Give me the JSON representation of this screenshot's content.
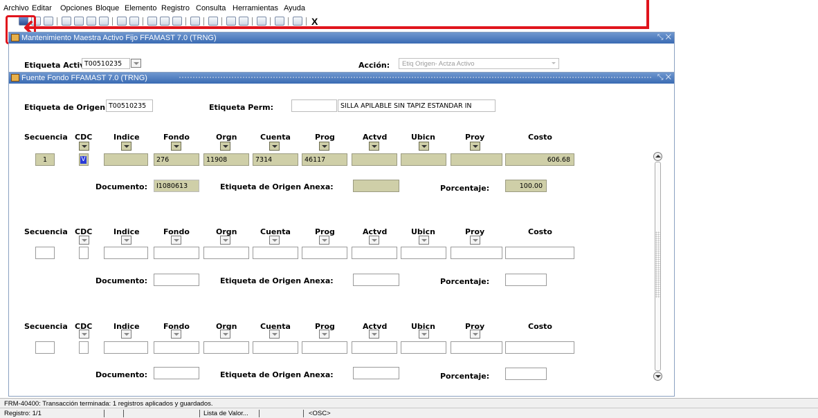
{
  "menu": [
    "Archivo",
    "Editar",
    "Opciones",
    "Bloque",
    "Elemento",
    "Registro",
    "Consulta",
    "Herramientas",
    "Ayuda"
  ],
  "outer_window": {
    "title": "Mantenimiento Maestra Activo Fijo  FFAMAST  7.0  (TRNG)",
    "etiqueta_label": "Etiqueta Activ",
    "etiqueta_value": "T00510235",
    "accion_label": "Acción:",
    "accion_value": "Etiq Origen- Actza Activo"
  },
  "inner_window": {
    "title": "Fuente Fondo  FFAMAST  7.0  (TRNG)",
    "origen_label": "Etiqueta de Origen:",
    "origen_value": "T00510235",
    "perm_label": "Etiqueta Perm:",
    "perm_value": "",
    "description": "SILLA APILABLE SIN TAPIZ ESTANDAR IN"
  },
  "columns": [
    "Secuencia",
    "CDC",
    "Indice",
    "Fondo",
    "Orgn",
    "Cuenta",
    "Prog",
    "Actvd",
    "Ubicn",
    "Proy",
    "Costo"
  ],
  "record1": {
    "secuencia": "1",
    "cdc": "V",
    "indice": "",
    "fondo": "276",
    "orgn": "11908",
    "cuenta": "7314",
    "prog": "46117",
    "actvd": "",
    "ubicn": "",
    "proy": "",
    "costo": "606.68",
    "documento": "I1080613",
    "anexa": "",
    "porcentaje": "100.00"
  },
  "labels": {
    "documento": "Documento:",
    "anexa": "Etiqueta de Origen Anexa:",
    "porcentaje": "Porcentaje:"
  },
  "status": {
    "message": "FRM-40400: Transacción terminada: 1 registros aplicados y guardados.",
    "registro": "Registro: 1/1",
    "lista": "Lista de Valor...",
    "osc": "<OSC>"
  },
  "colors": {
    "title_bar": "#3a6bb3",
    "field_filled": "#cfcfa8",
    "highlight_red": "#e0141c"
  },
  "toolbar_close_label": "X"
}
